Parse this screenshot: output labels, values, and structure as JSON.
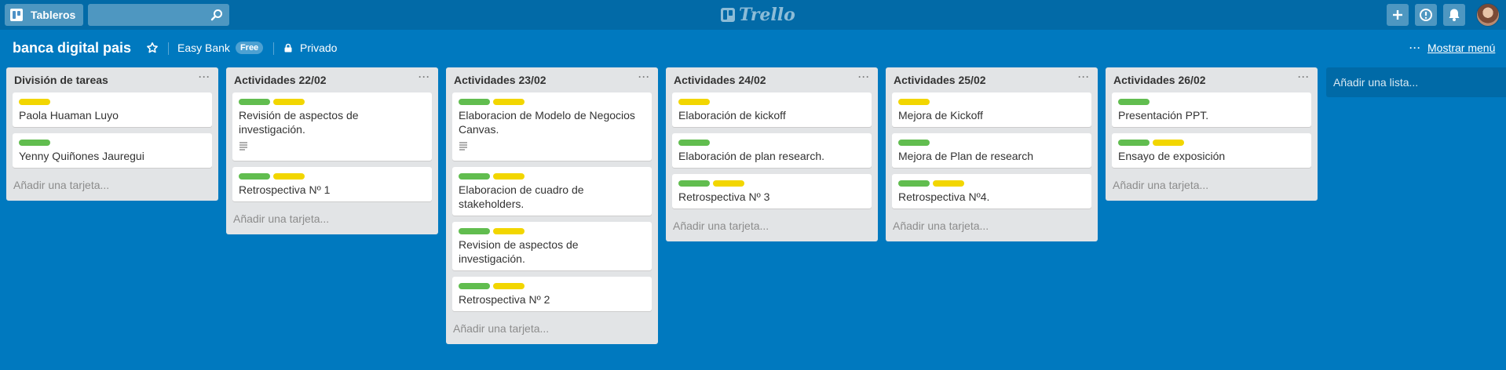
{
  "header": {
    "boards_label": "Tableros",
    "search_placeholder": "",
    "logo_text": "Trello"
  },
  "board": {
    "title": "banca digital pais",
    "team": "Easy Bank",
    "team_badge": "Free",
    "visibility": "Privado",
    "menu_label": "Mostrar menú",
    "add_list_label": "Añadir una lista..."
  },
  "colors": {
    "green": "#61bd4f",
    "yellow": "#f2d600",
    "board_bg": "#0079bf",
    "header_bg": "#026aa7"
  },
  "lists": [
    {
      "title": "División de tareas",
      "add_card": "Añadir una tarjeta...",
      "cards": [
        {
          "title": "Paola Huaman Luyo",
          "labels": [
            "yellow"
          ],
          "desc": false
        },
        {
          "title": "Yenny Quiñones Jauregui",
          "labels": [
            "green"
          ],
          "desc": false
        }
      ]
    },
    {
      "title": "Actividades 22/02",
      "add_card": "Añadir una tarjeta...",
      "cards": [
        {
          "title": "Revisión de aspectos de investigación.",
          "labels": [
            "green",
            "yellow"
          ],
          "desc": true
        },
        {
          "title": "Retrospectiva Nº 1",
          "labels": [
            "green",
            "yellow"
          ],
          "desc": false
        }
      ]
    },
    {
      "title": "Actividades 23/02",
      "add_card": "Añadir una tarjeta...",
      "cards": [
        {
          "title": "Elaboracion de Modelo de Negocios Canvas.",
          "labels": [
            "green",
            "yellow"
          ],
          "desc": true
        },
        {
          "title": "Elaboracion de cuadro de stakeholders.",
          "labels": [
            "green",
            "yellow"
          ],
          "desc": false
        },
        {
          "title": "Revision de aspectos de investigación.",
          "labels": [
            "green",
            "yellow"
          ],
          "desc": false
        },
        {
          "title": "Retrospectiva Nº 2",
          "labels": [
            "green",
            "yellow"
          ],
          "desc": false
        }
      ]
    },
    {
      "title": "Actividades 24/02",
      "add_card": "Añadir una tarjeta...",
      "cards": [
        {
          "title": "Elaboración de kickoff",
          "labels": [
            "yellow"
          ],
          "desc": false
        },
        {
          "title": "Elaboración de plan research.",
          "labels": [
            "green"
          ],
          "desc": false
        },
        {
          "title": "Retrospectiva Nº 3",
          "labels": [
            "green",
            "yellow"
          ],
          "desc": false
        }
      ]
    },
    {
      "title": "Actividades 25/02",
      "add_card": "Añadir una tarjeta...",
      "cards": [
        {
          "title": "Mejora de Kickoff",
          "labels": [
            "yellow"
          ],
          "desc": false
        },
        {
          "title": "Mejora de Plan de research",
          "labels": [
            "green"
          ],
          "desc": false
        },
        {
          "title": "Retrospectiva Nº4.",
          "labels": [
            "green",
            "yellow"
          ],
          "desc": false
        }
      ]
    },
    {
      "title": "Actividades 26/02",
      "add_card": "Añadir una tarjeta...",
      "cards": [
        {
          "title": "Presentación PPT.",
          "labels": [
            "green"
          ],
          "desc": false
        },
        {
          "title": "Ensayo de exposición",
          "labels": [
            "green",
            "yellow"
          ],
          "desc": false
        }
      ]
    }
  ]
}
